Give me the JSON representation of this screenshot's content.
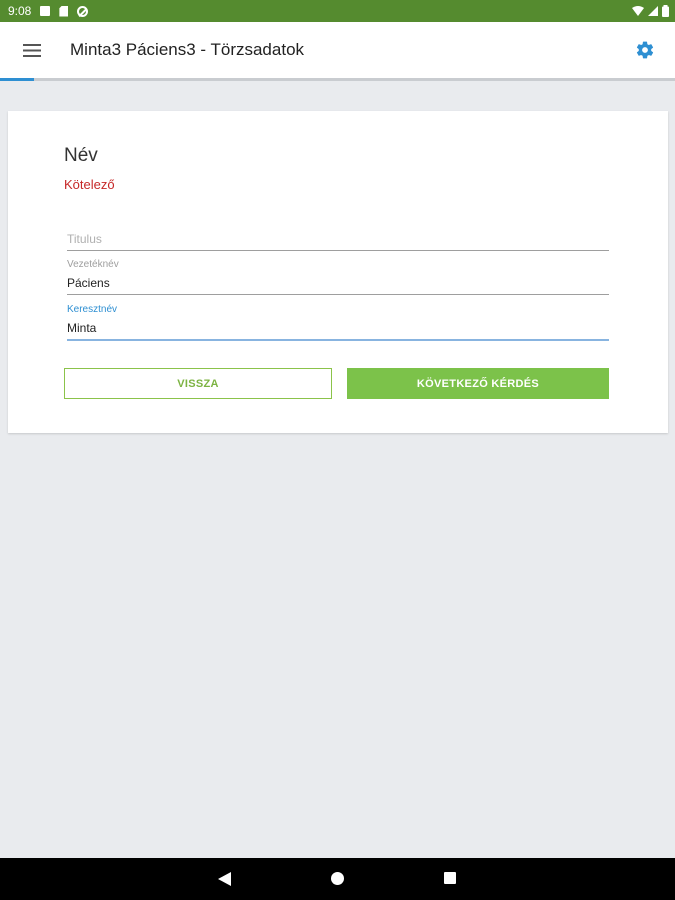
{
  "status_bar": {
    "time": "9:08"
  },
  "app_bar": {
    "title": "Minta3 Páciens3 - Törzsadatok"
  },
  "progress": {
    "fraction": 0.05
  },
  "question": {
    "title": "Név",
    "required_label": "Kötelező"
  },
  "fields": {
    "title": {
      "placeholder": "Titulus",
      "value": ""
    },
    "last_name": {
      "label": "Vezetéknév",
      "value": "Páciens"
    },
    "first_name": {
      "label": "Keresztnév",
      "value": "Minta"
    }
  },
  "buttons": {
    "back_label": "VISSZA",
    "next_label": "KÖVETKEZŐ KÉRDÉS"
  },
  "colors": {
    "status_bar": "#558b2f",
    "accent_blue": "#2e8fd2",
    "green": "#7cc24a",
    "required_red": "#c62828"
  }
}
